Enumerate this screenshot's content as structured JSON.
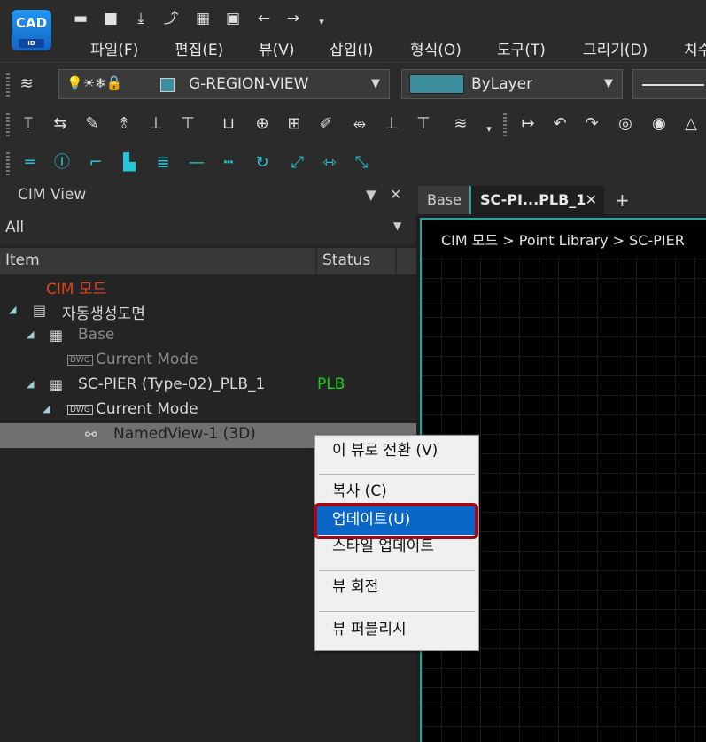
{
  "app": {
    "logo_text": "CAD",
    "logo_sub": "ID",
    "brand_color": "#1e88e5"
  },
  "quick_access": [
    "new-icon",
    "open-icon",
    "download-icon",
    "export-icon",
    "print-icon",
    "save-as-icon",
    "undo-icon",
    "redo-icon",
    "customize-icon"
  ],
  "menu": [
    "파일(F)",
    "편집(E)",
    "뷰(V)",
    "삽입(I)",
    "형식(O)",
    "도구(T)",
    "그리기(D)",
    "치수"
  ],
  "layer_toolbar": {
    "layer_name": "G-REGION-VIEW",
    "color_label": "ByLayer",
    "color_swatch": "#3d8fa0"
  },
  "panel": {
    "title": "CIM View",
    "pin": "📌",
    "close": "✕",
    "filter_value": "All",
    "columns": {
      "item": "Item",
      "status": "Status"
    },
    "tree": [
      {
        "label": "CIM 모드",
        "color": "#e0441b"
      },
      {
        "label": "자동생성도면",
        "expander": "◢"
      },
      {
        "label": "Base",
        "expander": "◢"
      },
      {
        "label": "Current Mode",
        "icon_text": "DWG"
      },
      {
        "label": "SC-PIER (Type-02)_PLB_1",
        "status": "PLB",
        "status_color": "#19d019",
        "expander": "◢"
      },
      {
        "label": "Current Mode",
        "icon_text": "DWG",
        "expander": "◢"
      },
      {
        "label": "NamedView-1 (3D)",
        "selected": true
      }
    ]
  },
  "tabs": [
    {
      "label": "Base",
      "active": false
    },
    {
      "label": "SC-PI...PLB_1",
      "active": true
    }
  ],
  "tab_close": "✕",
  "tab_add": "+",
  "breadcrumb": "CIM 모드 > Point Library > SC-PIER",
  "context_menu": {
    "items": [
      {
        "label": "이 뷰로 전환 (V)"
      },
      {
        "label": "복사 (C)"
      },
      {
        "label": "업데이트(U)",
        "highlighted": true
      },
      {
        "label": "스타일 업데이트"
      },
      {
        "label": "뷰 회전"
      },
      {
        "label": "뷰 퍼블리시"
      }
    ],
    "highlight_color": "#0a67c8",
    "annotation_color": "#a00a1a"
  }
}
